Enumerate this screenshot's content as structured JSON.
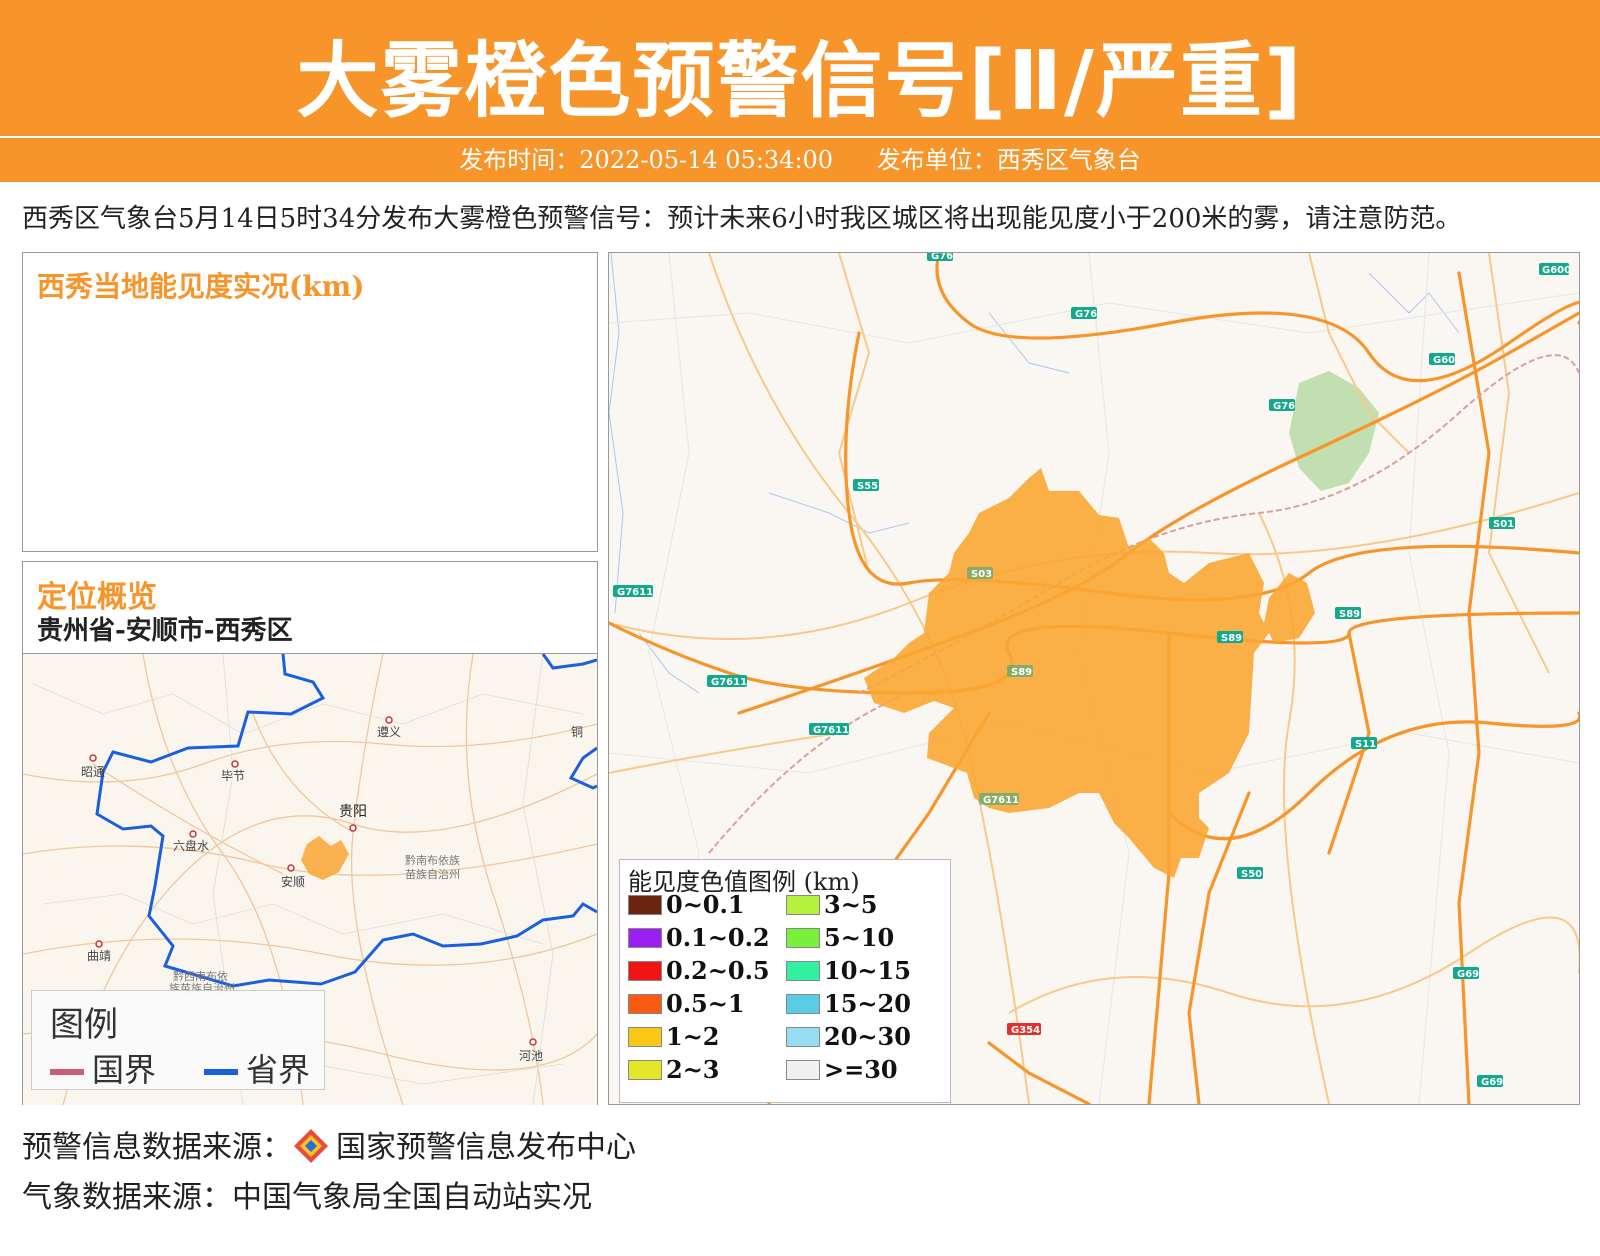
{
  "header": {
    "title": "大雾橙色预警信号[Ⅱ/严重]",
    "publish_time": "发布时间：2022-05-14 05:34:00",
    "publish_unit": "发布单位：西秀区气象台"
  },
  "description": "西秀区气象台5月14日5时34分发布大雾橙色预警信号：预计未来6小时我区城区将出现能见度小于200米的雾，请注意防范。",
  "visibility_panel": {
    "title": "西秀当地能见度实况(km)"
  },
  "location_panel": {
    "title": "定位概览",
    "location": "贵州省-安顺市-西秀区",
    "cities": [
      "遵义",
      "昭通",
      "毕节",
      "贵阳",
      "六盘水",
      "安顺",
      "曲靖",
      "河池",
      "铜"
    ],
    "region_labels": [
      "黔南布依族",
      "苗族自治州",
      "黔西南布依",
      "族苗族自治州"
    ],
    "legend": {
      "title": "图例",
      "national": "国界",
      "provincial": "省界",
      "national_color": "#c8607a",
      "provincial_color": "#1a5fe0"
    }
  },
  "main_map": {
    "road_labels": [
      "G76",
      "G76",
      "G600",
      "G60",
      "G76",
      "S55",
      "S01",
      "S03",
      "G7611",
      "S89",
      "S89",
      "G7611",
      "S89",
      "G7611",
      "S11",
      "G7611",
      "S50",
      "G69",
      "G354",
      "G69"
    ],
    "warning_area_color": "#f9a634",
    "legend": {
      "title": "能见度色值图例 (km)",
      "items": [
        {
          "label": "0~0.1",
          "color": "#6b2410"
        },
        {
          "label": "0.1~0.2",
          "color": "#9b1ff0"
        },
        {
          "label": "0.2~0.5",
          "color": "#f01414"
        },
        {
          "label": "0.5~1",
          "color": "#f85a14"
        },
        {
          "label": "1~2",
          "color": "#f8c814"
        },
        {
          "label": "2~3",
          "color": "#e6e628"
        },
        {
          "label": "3~5",
          "color": "#b4f03c"
        },
        {
          "label": "5~10",
          "color": "#78f03c"
        },
        {
          "label": "10~15",
          "color": "#32f0a0"
        },
        {
          "label": "15~20",
          "color": "#5acde6"
        },
        {
          "label": "20~30",
          "color": "#96dcf5"
        },
        {
          "label": ">=30",
          "color": "#f0f0f0"
        }
      ]
    }
  },
  "sources": {
    "warning_source": "预警信息数据来源：",
    "warning_org": "国家预警信息发布中心",
    "weather_source": "气象数据来源：中国气象局全国自动站实况"
  }
}
